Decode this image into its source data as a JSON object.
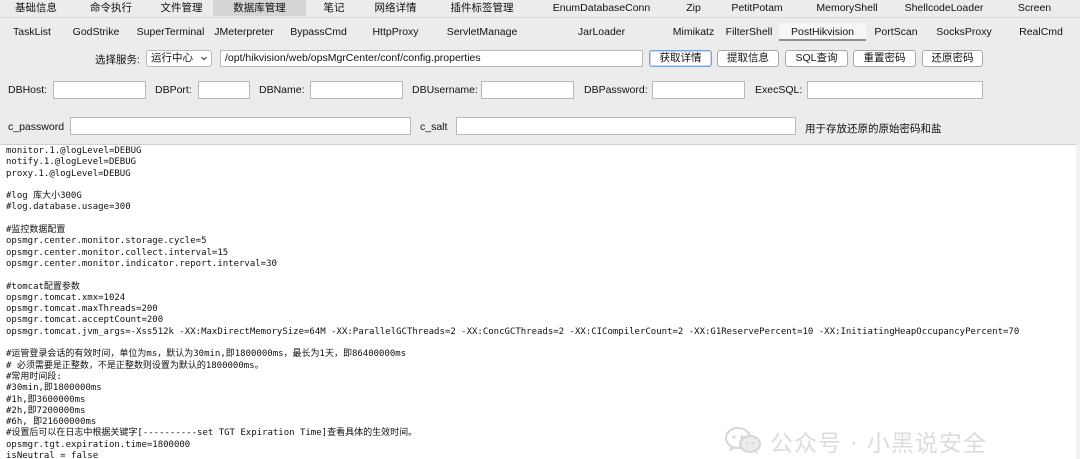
{
  "tabs_row1": [
    {
      "label": "基础信息",
      "active": false
    },
    {
      "label": "命令执行",
      "active": false
    },
    {
      "label": "文件管理",
      "active": false
    },
    {
      "label": "数据库管理",
      "active": true
    },
    {
      "label": "笔记",
      "active": false
    },
    {
      "label": "网络详情",
      "active": false
    },
    {
      "label": "插件标签管理",
      "active": false
    },
    {
      "label": "EnumDatabaseConn",
      "active": false
    },
    {
      "label": "Zip",
      "active": false
    },
    {
      "label": "PetitPotam",
      "active": false
    },
    {
      "label": "MemoryShell",
      "active": false
    },
    {
      "label": "ShellcodeLoader",
      "active": false
    },
    {
      "label": "Screen",
      "active": false
    }
  ],
  "tabs_row2": [
    {
      "label": "TaskList",
      "active": false
    },
    {
      "label": "GodStrike",
      "active": false
    },
    {
      "label": "SuperTerminal",
      "active": false
    },
    {
      "label": "JMeterpreter",
      "active": false
    },
    {
      "label": "BypassCmd",
      "active": false
    },
    {
      "label": "HttpProxy",
      "active": false
    },
    {
      "label": "ServletManage",
      "active": false
    },
    {
      "label": "JarLoader",
      "active": false
    },
    {
      "label": "Mimikatz",
      "active": false
    },
    {
      "label": "FilterShell",
      "active": false
    },
    {
      "label": "PostHikvision",
      "active": true
    },
    {
      "label": "PortScan",
      "active": false
    },
    {
      "label": "SocksProxy",
      "active": false
    },
    {
      "label": "RealCmd",
      "active": false
    }
  ],
  "toolbar": {
    "service_label": "选择服务:",
    "service_value": "运行中心",
    "path_value": "/opt/hikvision/web/opsMgrCenter/conf/config.properties",
    "buttons": [
      "获取详情",
      "提取信息",
      "SQL查询",
      "重置密码",
      "还原密码"
    ]
  },
  "db_fields": {
    "host_label": "DBHost:",
    "port_label": "DBPort:",
    "name_label": "DBName:",
    "username_label": "DBUsername:",
    "password_label": "DBPassword:",
    "exec_label": "ExecSQL:"
  },
  "restore": {
    "cpassword_label": "c_password",
    "csalt_label": "c_salt",
    "hint": "用于存放还原的原始密码和盐"
  },
  "config_lines": [
    "monitor.1.@logLevel=DEBUG",
    "notify.1.@logLevel=DEBUG",
    "proxy.1.@logLevel=DEBUG",
    "",
    "#log 库大小300G",
    "#log.database.usage=300",
    "",
    "#监控数据配置",
    "opsmgr.center.monitor.storage.cycle=5",
    "opsmgr.center.monitor.collect.interval=15",
    "opsmgr.center.monitor.indicator.report.interval=30",
    "",
    "#tomcat配置参数",
    "opsmgr.tomcat.xmx=1024",
    "opsmgr.tomcat.maxThreads=200",
    "opsmgr.tomcat.acceptCount=200",
    "opsmgr.tomcat.jvm_args=-Xss512k -XX:MaxDirectMemorySize=64M -XX:ParallelGCThreads=2 -XX:ConcGCThreads=2 -XX:CICompilerCount=2 -XX:G1ReservePercent=10 -XX:InitiatingHeapOccupancyPercent=70",
    "",
    "#运管登录会话的有效时间，单位为ms，默认为30min,即1800000ms，最长为1天，即86400000ms",
    "# 必须需要是正整数，不是正整数则设置为默认的1800000ms。",
    "#常用时间段:",
    "#30min,即1800000ms",
    "#1h,即3600000ms",
    "#2h,即7200000ms",
    "#6h, 即21600000ms",
    "#设置后可以在日志中根据关键字[----------set TGT Expiration Time]查看具体的生效时间。",
    "opsmgr.tgt.expiration.time=1800000",
    "isNeutral = false"
  ],
  "watermark": "公众号 · 小黑说安全"
}
